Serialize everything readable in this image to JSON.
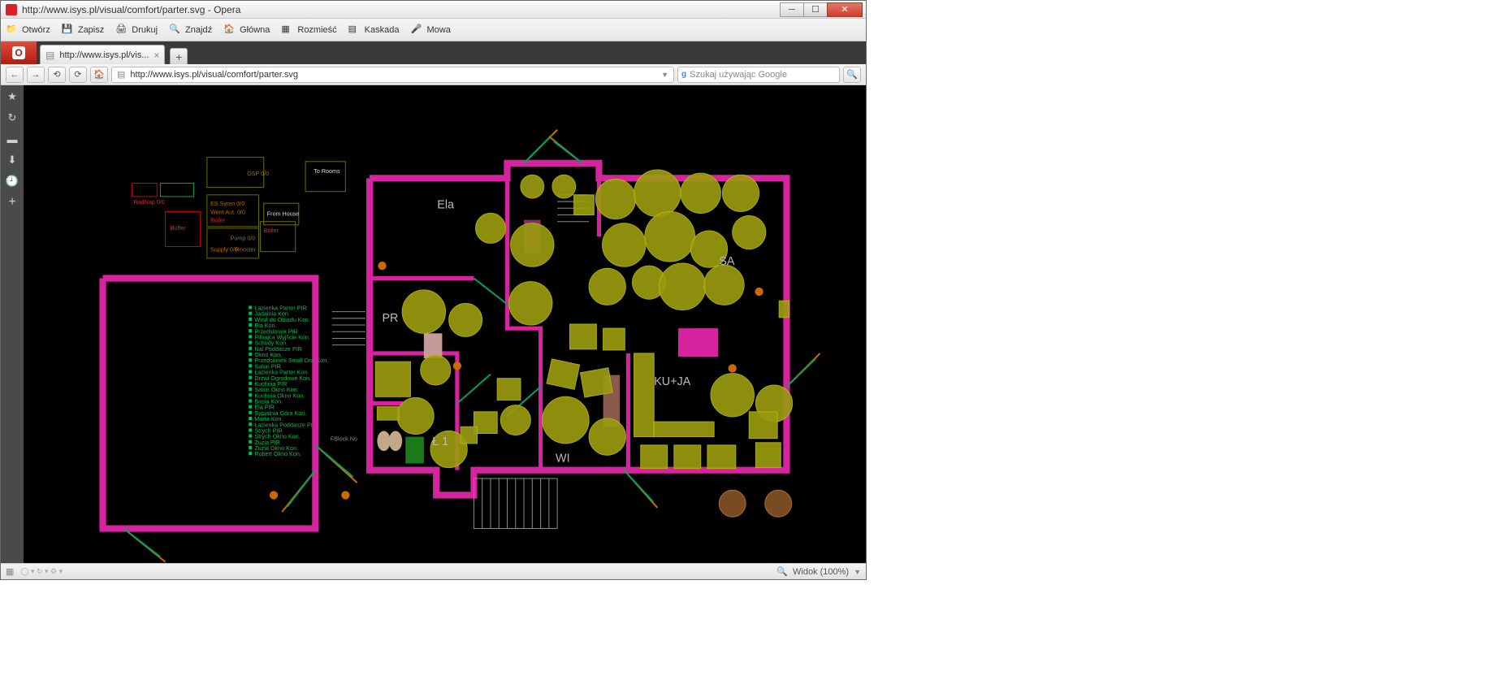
{
  "window": {
    "title": "http://www.isys.pl/visual/comfort/parter.svg - Opera"
  },
  "toolbar": {
    "open": "Otwórz",
    "save": "Zapisz",
    "print": "Drukuj",
    "find": "Znajdź",
    "home": "Główna",
    "tile": "Rozmieść",
    "cascade": "Kaskada",
    "voice": "Mowa"
  },
  "tab": {
    "title": "http://www.isys.pl/vis..."
  },
  "address": {
    "url": "http://www.isys.pl/visual/comfort/parter.svg"
  },
  "search": {
    "placeholder": "Szukaj używając Google"
  },
  "status": {
    "zoom": "Widok (100%)"
  },
  "plan": {
    "rooms": {
      "ela": "Ela",
      "pr": "PR",
      "l1": "Ł 1",
      "sa": "SA",
      "kuja": "KU+JA",
      "wi": "WI"
    },
    "panel": {
      "to_rooms": "To Rooms",
      "from_house": "From House",
      "buffer": "Buffer",
      "boiler1": "Boiler",
      "boiler2": "Boiler",
      "es": "ES Syren 0/0",
      "went": "Went Aut. 0/0",
      "osp": "OSP 0/0",
      "pump": "Pump 0/0",
      "supply": "Supply 0/0",
      "radnap": "RadNap 0/0",
      "rooster": "Rooster",
      "fblock": "FBlock No"
    },
    "legend": [
      "Łazienka Parter PIR",
      "Jadalnia Kon.",
      "Wind do Obiadu Kon.",
      "Ela Kon.",
      "Przedsionek PIR",
      "Pilnujca Wyjście Kon.",
      "Schody Kon.",
      "Nal Poddasze PIR",
      "Okno Kon.",
      "Przedsionek Small Drw Kon.",
      "Salon PIR",
      "Łazienka Parter Kon.",
      "Drzwi Ogrodowe Kon.",
      "Kuchnia PIR",
      "Salon Okno Kon.",
      "Kuchnia Okno Kon.",
      "Basia Kon.",
      "Ela PIR",
      "Sypialnia Góra Kon.",
      "Marta Kon.",
      "Łazienka Poddasze PIR",
      "Strych PIR",
      "Strych Okno Kon.",
      "Zuzia PIR",
      "Zuzia Okno Kon.",
      "Robert Okno Kon."
    ]
  }
}
